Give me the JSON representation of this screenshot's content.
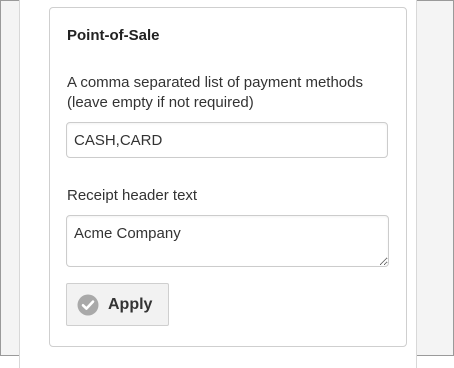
{
  "section": {
    "title": "Point-of-Sale"
  },
  "payment_methods": {
    "label_line1": "A comma separated list of payment methods",
    "label_line2": "(leave empty if not required)",
    "value": "CASH,CARD"
  },
  "receipt_header": {
    "label": "Receipt header text",
    "value": "Acme Company"
  },
  "apply_button": {
    "label": "Apply",
    "icon": "check-circle-icon"
  },
  "colors": {
    "icon_fill": "#a9a9a9",
    "button_bg": "#f2f2f2",
    "border": "#cccccc"
  }
}
